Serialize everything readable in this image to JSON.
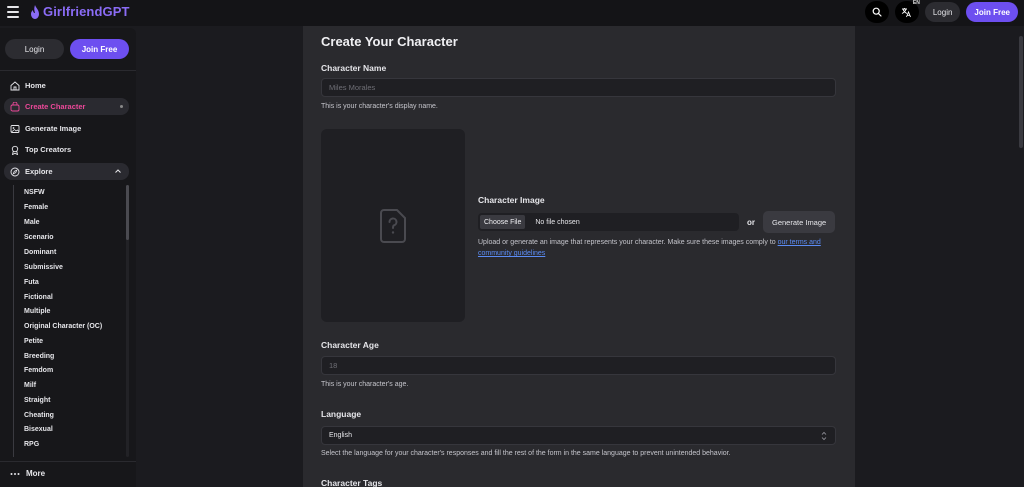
{
  "topbar": {
    "brand": "GirlfriendGPT",
    "lang_badge": "EN",
    "login_label": "Login",
    "join_label": "Join Free"
  },
  "sidebar": {
    "login_label": "Login",
    "join_label": "Join Free",
    "nav": [
      {
        "label": "Home",
        "icon": "home-icon"
      },
      {
        "label": "Create Character",
        "icon": "create-character-icon",
        "active": true
      },
      {
        "label": "Generate Image",
        "icon": "image-icon"
      },
      {
        "label": "Top Creators",
        "icon": "award-icon"
      },
      {
        "label": "Explore",
        "icon": "compass-icon"
      }
    ],
    "explore_items": [
      "NSFW",
      "Female",
      "Male",
      "Scenario",
      "Dominant",
      "Submissive",
      "Futa",
      "Fictional",
      "Multiple",
      "Original Character (OC)",
      "Petite",
      "Breeding",
      "Femdom",
      "Milf",
      "Straight",
      "Cheating",
      "Bisexual",
      "RPG"
    ],
    "more_label": "More"
  },
  "form": {
    "title": "Create Your Character",
    "name_label": "Character Name",
    "name_placeholder": "Miles Morales",
    "name_help": "This is your character's display name.",
    "image_label": "Character Image",
    "choose_file_label": "Choose File",
    "file_status": "No file chosen",
    "or_label": "or",
    "generate_image_label": "Generate Image",
    "image_help_prefix": "Upload or generate an image that represents your character. Make sure these images comply to ",
    "image_help_link": "our terms and community guidelines",
    "age_label": "Character Age",
    "age_placeholder": "18",
    "age_help": "This is your character's age.",
    "language_label": "Language",
    "language_value": "English",
    "language_help": "Select the language for your character's responses and fill the rest of the form in the same language to prevent unintended behavior.",
    "tags_label": "Character Tags"
  },
  "colors": {
    "accent": "#6d4ff0",
    "brand": "#8b6cf6",
    "active_nav": "#ec4899",
    "link": "#5b8cf5"
  }
}
